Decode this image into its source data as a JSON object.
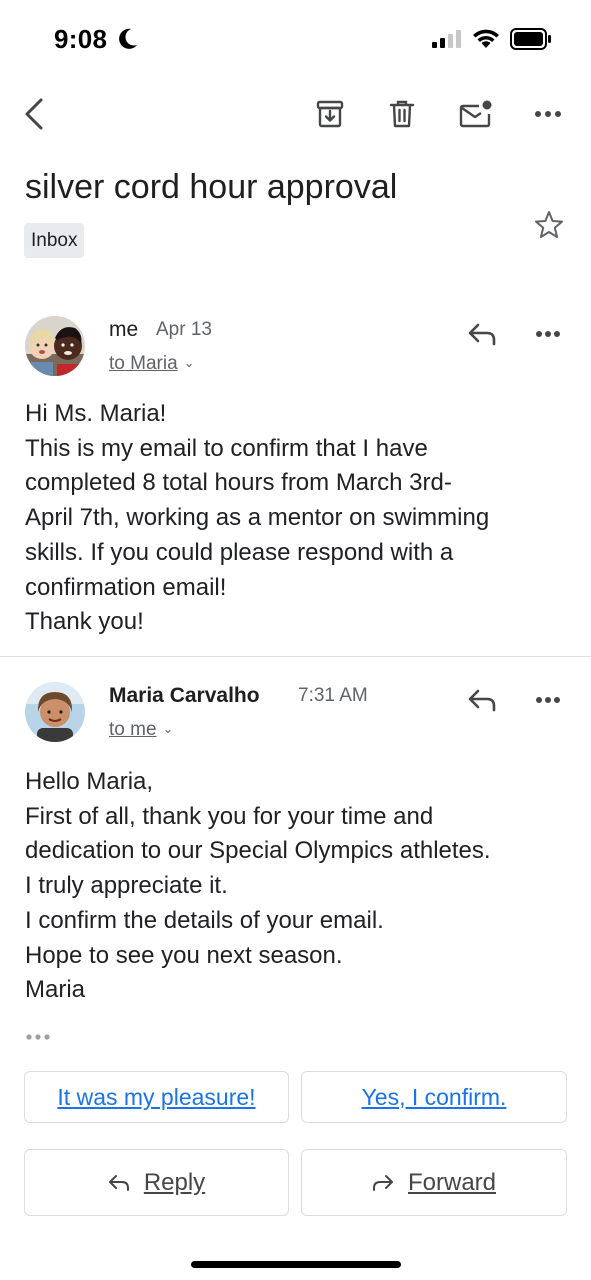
{
  "status_bar": {
    "time": "9:08"
  },
  "email": {
    "subject": "silver cord hour approval",
    "label": "Inbox"
  },
  "messages": [
    {
      "sender": "me",
      "date": "Apr 13",
      "to": "to Maria",
      "body": [
        "Hi Ms. Maria!",
        "This is my email to confirm that I have",
        "completed 8 total hours from March 3rd-",
        "April 7th, working as a mentor on swimming",
        "skills. If you could please respond with a",
        "confirmation email!",
        "Thank you!"
      ]
    },
    {
      "sender": "Maria Carvalho",
      "date": "7:31 AM",
      "to": "to me",
      "body": [
        "Hello Maria,",
        "First of all, thank you for your time and",
        "dedication to our Special Olympics athletes.",
        "I truly appreciate it.",
        "I confirm the details of your email.",
        "Hope to see you next season.",
        "Maria"
      ]
    }
  ],
  "smart_replies": [
    "It was my pleasure!",
    "Yes, I confirm."
  ],
  "actions": {
    "reply": "Reply",
    "forward": "Forward"
  },
  "colors": {
    "link_blue": "#1a73e8",
    "secondary_text": "#5f6368",
    "chip_bg": "#e8eaed"
  }
}
